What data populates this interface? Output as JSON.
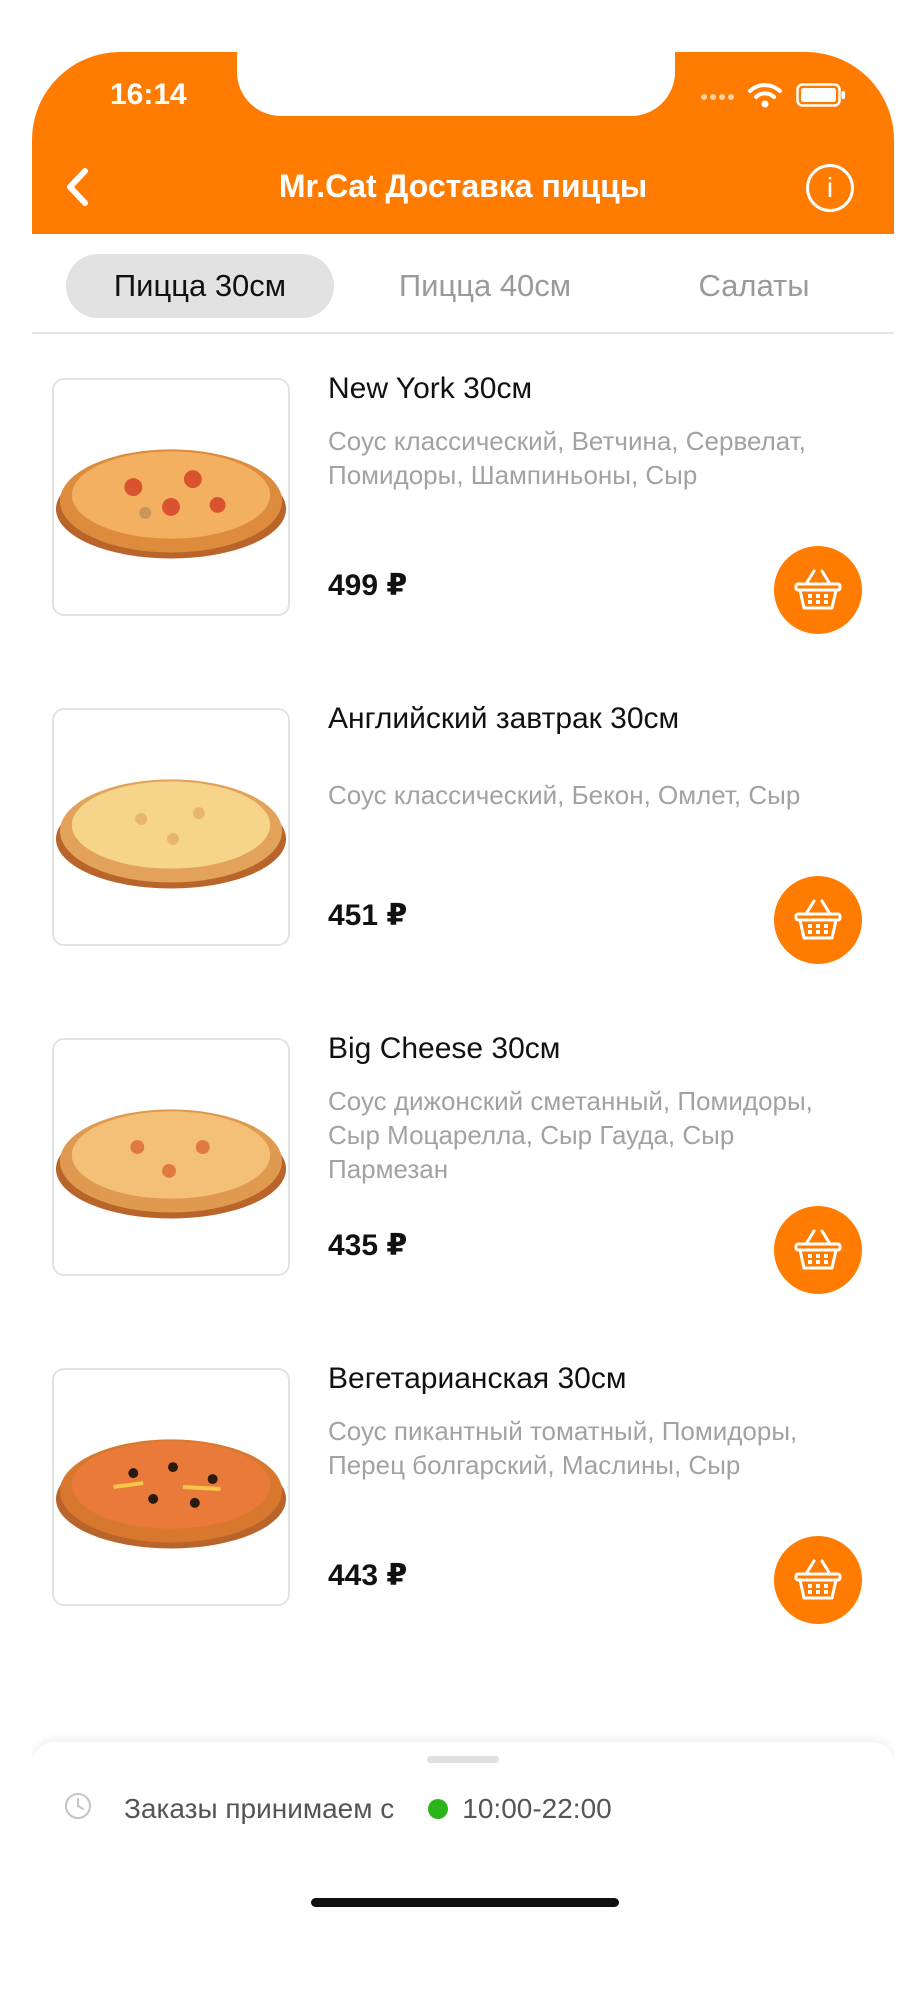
{
  "status_bar": {
    "time": "16:14"
  },
  "header": {
    "title": "Mr.Cat Доставка пиццы"
  },
  "tabs": [
    {
      "label": "Пицца 30см",
      "active": true
    },
    {
      "label": "Пицца 40см",
      "active": false
    },
    {
      "label": "Салаты",
      "active": false
    }
  ],
  "items": [
    {
      "name": "New York  30см",
      "description": "Соус классический, Ветчина, Сервелат, Помидоры, Шампиньоны, Сыр",
      "price": "499 ₽"
    },
    {
      "name": "Английский завтрак  30см",
      "description": "Соус классический, Бекон, Омлет, Сыр",
      "price": "451 ₽"
    },
    {
      "name": "Big Cheese  30см",
      "description": "Соус дижонский сметанный, Помидоры, Сыр Моцарелла, Сыр Гауда, Сыр Пармезан",
      "price": "435 ₽"
    },
    {
      "name": "Вегетарианская  30см",
      "description": "Соус пикантный томатный, Помидоры, Перец болгарский, Маслины, Сыр",
      "price": "443 ₽"
    }
  ],
  "footer": {
    "label": "Заказы принимаем с",
    "hours": "10:00-22:00"
  },
  "colors": {
    "accent": "#ff7c00",
    "status_open": "#2bb51a"
  }
}
